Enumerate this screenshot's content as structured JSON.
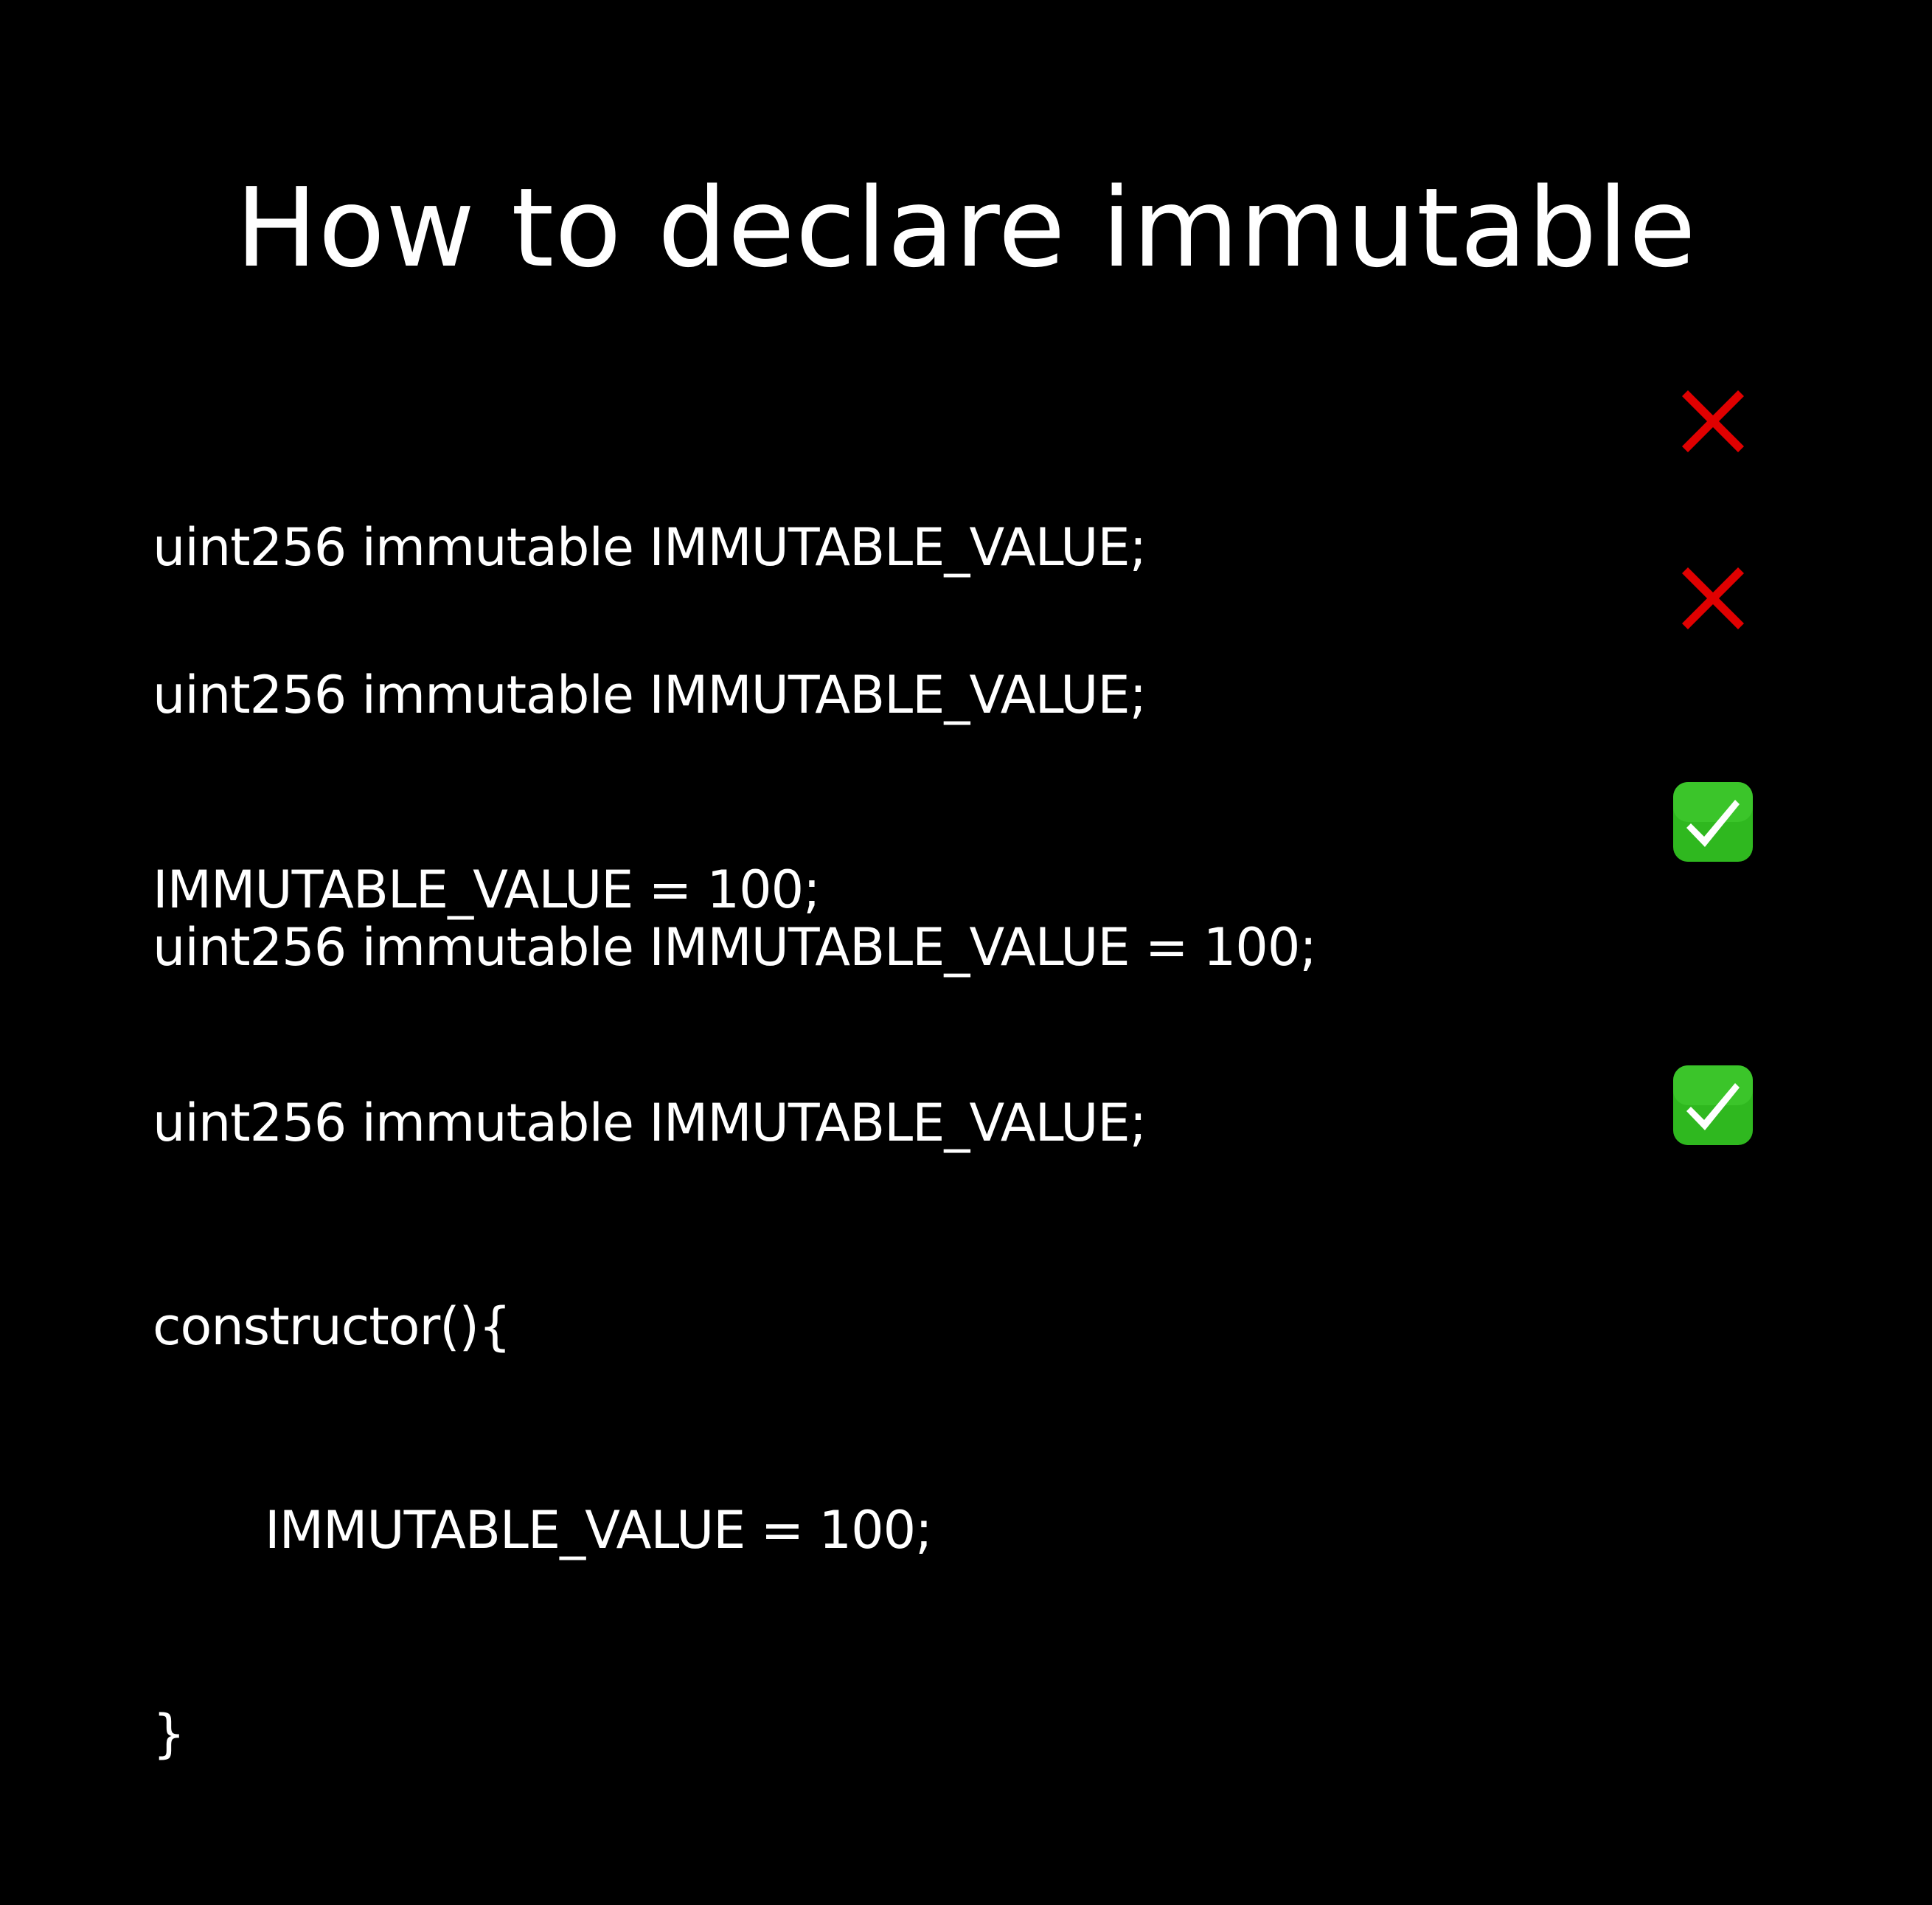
{
  "slide": {
    "title": "How to declare immutable",
    "examples": [
      {
        "lines": [
          "uint256 immutable IMMUTABLE_VALUE;"
        ],
        "verdict": "incorrect",
        "icon": "red-cross-icon"
      },
      {
        "lines": [
          "uint256 immutable IMMUTABLE_VALUE;",
          "IMMUTABLE_VALUE = 100;"
        ],
        "verdict": "incorrect",
        "icon": "red-cross-icon"
      },
      {
        "lines": [
          "uint256 immutable IMMUTABLE_VALUE = 100;"
        ],
        "verdict": "correct",
        "icon": "green-check-icon"
      },
      {
        "lines": [
          "uint256 immutable IMMUTABLE_VALUE;",
          "constructor(){",
          "IMMUTABLE_VALUE = 100;",
          "}"
        ],
        "verdict": "correct",
        "icon": "green-check-icon"
      }
    ]
  },
  "colors": {
    "background": "#000000",
    "text": "#ffffff",
    "cross": "#e00000",
    "check_box": "#2fb81f",
    "check_mark": "#ffffff"
  }
}
